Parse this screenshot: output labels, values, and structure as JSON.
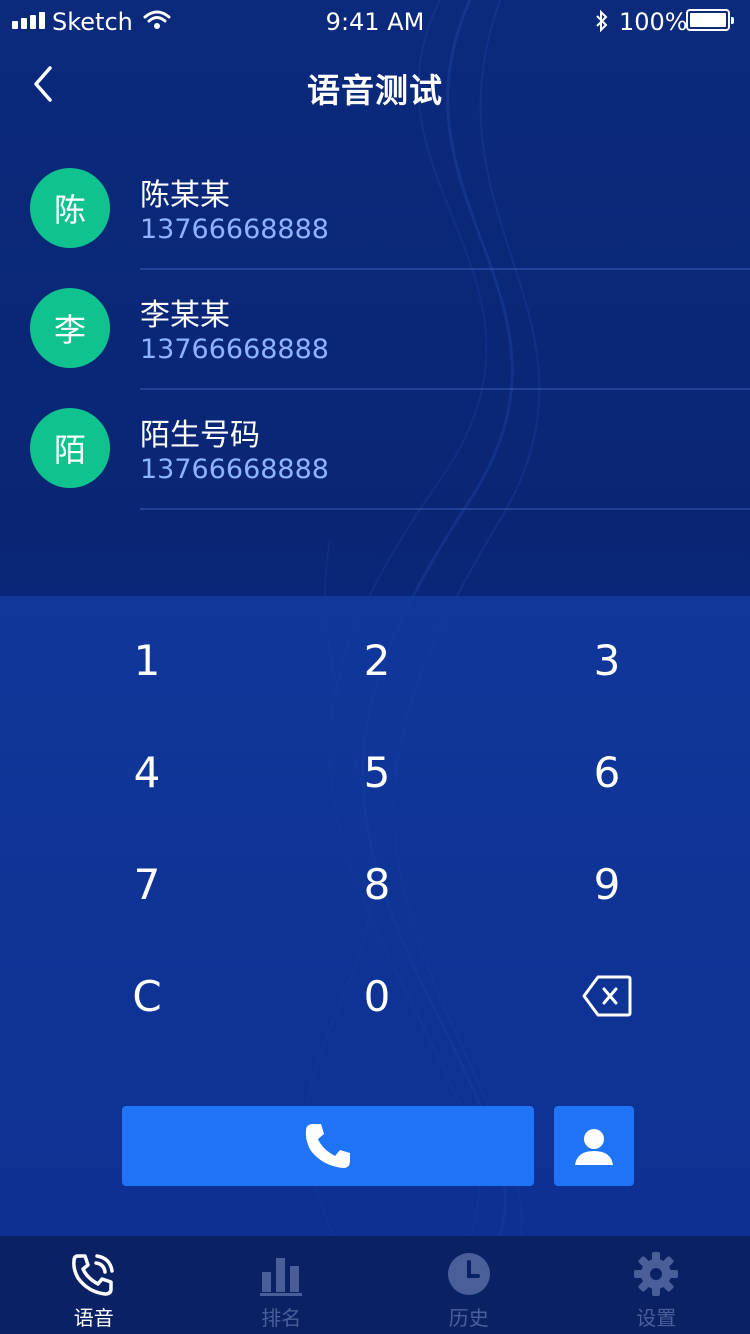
{
  "status_bar": {
    "carrier": "Sketch",
    "time": "9:41 AM",
    "battery": "100%"
  },
  "nav": {
    "title": "语音测试"
  },
  "contacts": [
    {
      "avatar": "陈",
      "name": "陈某某",
      "phone": "13766668888"
    },
    {
      "avatar": "李",
      "name": "李某某",
      "phone": "13766668888"
    },
    {
      "avatar": "陌",
      "name": "陌生号码",
      "phone": "13766668888"
    }
  ],
  "keypad": {
    "keys": [
      "1",
      "2",
      "3",
      "4",
      "5",
      "6",
      "7",
      "8",
      "9",
      "C",
      "0"
    ],
    "delete_icon": "backspace-icon"
  },
  "actions": {
    "call_icon": "phone-icon",
    "contacts_icon": "person-icon"
  },
  "tabs": [
    {
      "label": "语音",
      "icon": "phone-ring-icon",
      "active": true
    },
    {
      "label": "排名",
      "icon": "bar-chart-icon",
      "active": false
    },
    {
      "label": "历史",
      "icon": "clock-icon",
      "active": false
    },
    {
      "label": "设置",
      "icon": "gear-icon",
      "active": false
    }
  ],
  "colors": {
    "background": "#0b2a7c",
    "avatar": "#10c38e",
    "phone_text": "#8fb4ff",
    "button": "#1f73f7",
    "tabbar": "#0a2264",
    "tab_inactive": "#4a5f9a"
  }
}
